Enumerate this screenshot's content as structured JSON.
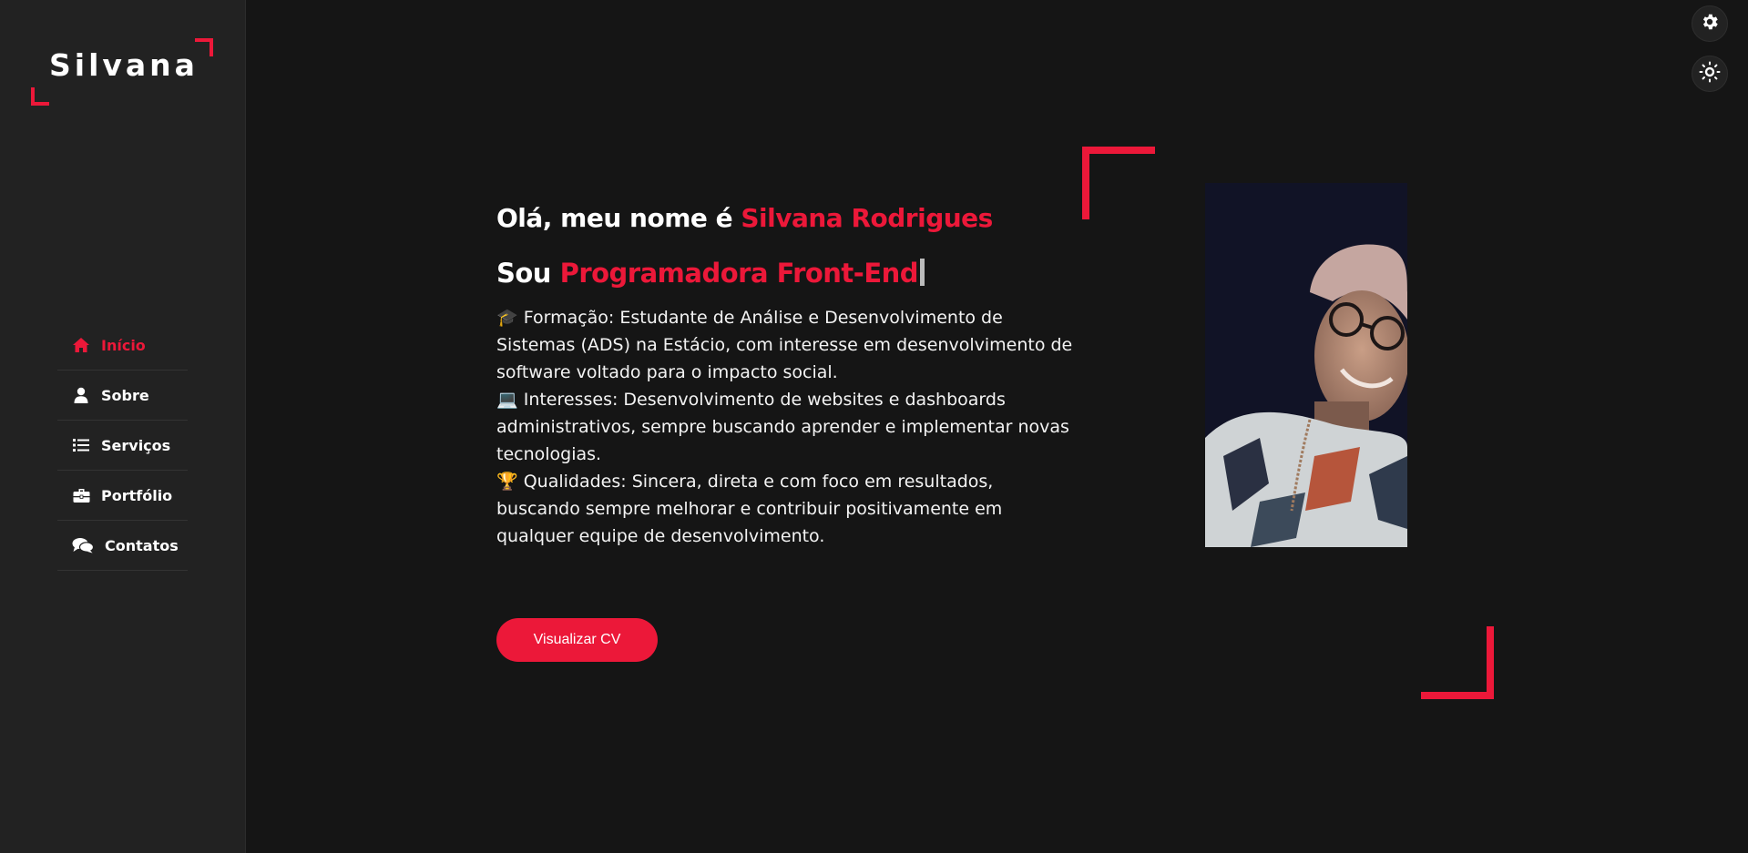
{
  "logo": {
    "text": "Silvana"
  },
  "nav": {
    "items": [
      {
        "label": "Início",
        "icon": "home-icon",
        "active": true
      },
      {
        "label": "Sobre",
        "icon": "user-icon",
        "active": false
      },
      {
        "label": "Serviços",
        "icon": "list-icon",
        "active": false
      },
      {
        "label": "Portfólio",
        "icon": "briefcase-icon",
        "active": false
      },
      {
        "label": "Contatos",
        "icon": "comments-icon",
        "active": false
      }
    ]
  },
  "controls": {
    "settings_icon": "gear-icon",
    "theme_icon": "sun-icon"
  },
  "hero": {
    "greeting_prefix": "Olá, meu nome é ",
    "name": "Silvana Rodrigues",
    "profession_prefix": "Sou ",
    "profession": "Programadora Front-End",
    "bio": [
      {
        "emoji": "🎓",
        "text": " Formação: Estudante de Análise e Desenvolvimento de Sistemas (ADS) na Estácio, com interesse em desenvolvimento de software voltado para o impacto social."
      },
      {
        "emoji": "💻",
        "text": " Interesses: Desenvolvimento de websites e dashboards administrativos, sempre buscando aprender e implementar novas tecnologias."
      },
      {
        "emoji": "🏆",
        "text": " Qualidades: Sincera, direta e com foco em resultados, buscando sempre melhorar e contribuir positivamente em qualquer equipe de desenvolvimento."
      }
    ],
    "cv_button": "Visualizar CV"
  },
  "colors": {
    "accent": "#ec1839",
    "background": "#151515",
    "sidebar": "#222222"
  }
}
